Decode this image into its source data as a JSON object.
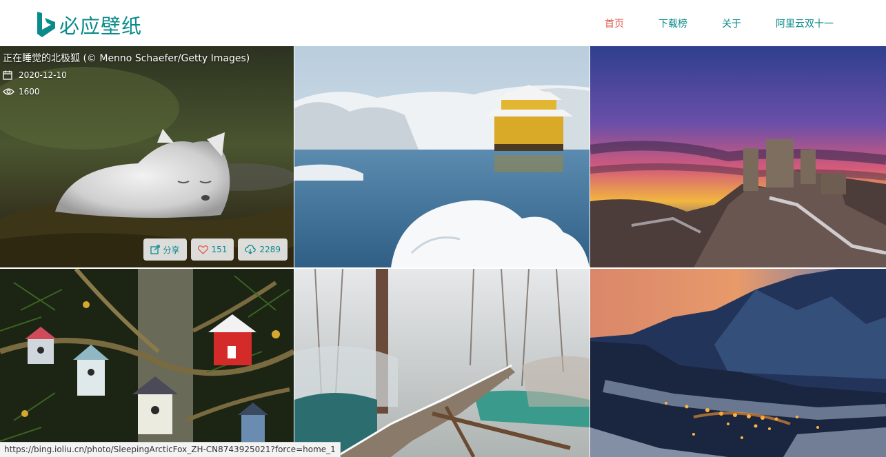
{
  "site": {
    "logo_text": "必应壁纸"
  },
  "nav": [
    {
      "label": "首页",
      "active": true
    },
    {
      "label": "下载榜",
      "active": false
    },
    {
      "label": "关于",
      "active": false
    },
    {
      "label": "阿里云双十一",
      "active": false
    }
  ],
  "featured": {
    "title": "正在睡觉的北极狐 (© Menno Schaefer/Getty Images)",
    "date": "2020-12-10",
    "views": "1600",
    "share_label": "分享",
    "likes": "151",
    "downloads": "2289"
  },
  "tiles": [
    {
      "subject": "sleeping-arctic-fox"
    },
    {
      "subject": "snowy-golden-pavilion"
    },
    {
      "subject": "castle-ruins-sunset"
    },
    {
      "subject": "birdhouses-in-pine-tree"
    },
    {
      "subject": "snowy-forest-boardwalk"
    },
    {
      "subject": "mountain-village-night"
    }
  ],
  "status_url": "https://bing.ioliu.cn/photo/SleepingArcticFox_ZH-CN8743925021?force=home_1",
  "colors": {
    "brand": "#0a8a8a",
    "nav_active": "#e05a4a"
  },
  "icons": [
    "bing-logo-icon",
    "calendar-icon",
    "eye-icon",
    "share-icon",
    "heart-icon",
    "cloud-download-icon"
  ]
}
